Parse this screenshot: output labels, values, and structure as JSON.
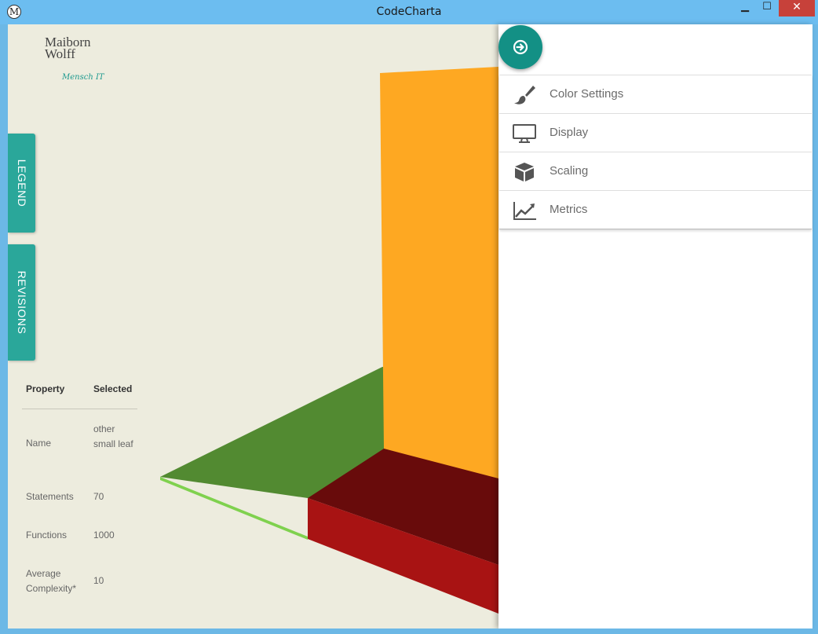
{
  "window": {
    "title": "CodeCharta",
    "icon_letter": "M",
    "minimize_glyph": "▁",
    "maximize_glyph": "☐",
    "close_glyph": "✕"
  },
  "logo": {
    "line1": "Maiborn",
    "line2": "Wolff",
    "tagline": "Mensch IT"
  },
  "side_tabs": {
    "legend": "LEGEND",
    "revisions": "REVISIONS"
  },
  "property_table": {
    "header_property": "Property",
    "header_selected": "Selected",
    "rows": [
      {
        "key": "Name",
        "value": "other small leaf"
      },
      {
        "key": "Statements",
        "value": "70"
      },
      {
        "key": "Functions",
        "value": "1000"
      },
      {
        "key": "Average Complexity*",
        "value": "10"
      }
    ]
  },
  "panel": {
    "menu": [
      {
        "label": "Color Settings",
        "icon": "paintbrush-icon"
      },
      {
        "label": "Display",
        "icon": "monitor-icon"
      },
      {
        "label": "Scaling",
        "icon": "cube-icon"
      },
      {
        "label": "Metrics",
        "icon": "trending-chart-icon"
      }
    ]
  },
  "colors": {
    "accent": "#139085",
    "tab_bg": "#2aa79a",
    "canvas_bg": "#edecde",
    "building_orange": "#fea822",
    "building_green": "#528a31",
    "building_red_top": "#680b0b",
    "building_red_side": "#a81313"
  }
}
